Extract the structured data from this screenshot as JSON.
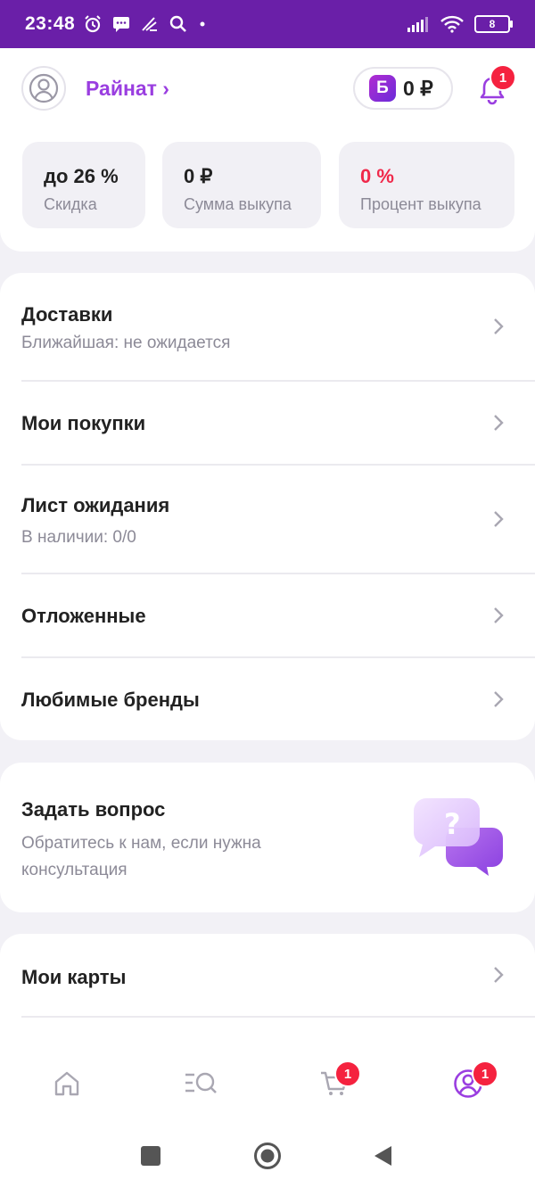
{
  "status_bar": {
    "time": "23:48",
    "battery": "8",
    "icons": [
      "alarm-icon",
      "message-icon",
      "app-icon",
      "search-icon",
      "dot-icon",
      "signal-icon",
      "wifi-icon",
      "battery-icon"
    ]
  },
  "header": {
    "user_name": "Райнат ›",
    "balance": "0 ₽",
    "balance_badge": "Б",
    "notifications_count": "1"
  },
  "stats": [
    {
      "value": "до 26 %",
      "label": "Скидка",
      "color": "#222222"
    },
    {
      "value": "0 ₽",
      "label": "Сумма выкупа",
      "color": "#222222"
    },
    {
      "value": "0 %",
      "label": "Процент выкупа",
      "color": "#f0284a"
    }
  ],
  "menu": {
    "deliveries": {
      "title": "Доставки",
      "subtitle": "Ближайшая: не ожидается"
    },
    "purchases": {
      "title": "Мои покупки"
    },
    "waitlist": {
      "title": "Лист ожидания",
      "subtitle": "В наличии: 0/0"
    },
    "postponed": {
      "title": "Отложенные"
    },
    "brands": {
      "title": "Любимые бренды"
    }
  },
  "support": {
    "title": "Задать вопрос",
    "text": "Обратитесь к нам, если нужна консультация"
  },
  "cards_section": {
    "title": "Мои карты"
  },
  "bottom_nav": {
    "items": [
      {
        "name": "home",
        "icon": "home-icon"
      },
      {
        "name": "catalog",
        "icon": "catalog-search-icon"
      },
      {
        "name": "cart",
        "icon": "cart-icon",
        "badge": "1"
      },
      {
        "name": "profile",
        "icon": "profile-icon",
        "badge": "1",
        "active": true
      }
    ]
  },
  "colors": {
    "accent": "#9a3ee0",
    "status_bar": "#6a1fa8",
    "badge": "#f5223f",
    "danger_text": "#f0284a"
  }
}
